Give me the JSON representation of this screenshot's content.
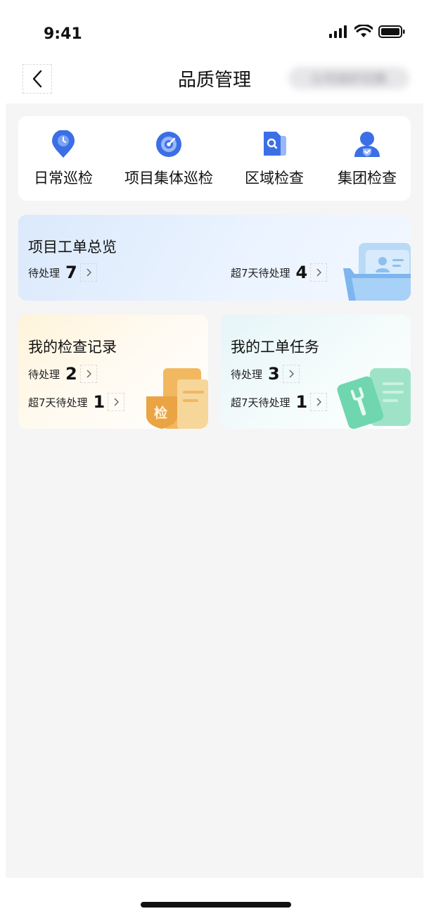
{
  "status": {
    "time": "9:41"
  },
  "nav": {
    "title": "品质管理",
    "right_label": "公司组织切换"
  },
  "quick_actions": [
    {
      "label": "日常巡检",
      "icon": "location-pin-icon"
    },
    {
      "label": "项目集体巡检",
      "icon": "target-icon"
    },
    {
      "label": "区域检查",
      "icon": "document-search-icon"
    },
    {
      "label": "集团检查",
      "icon": "user-shield-icon"
    }
  ],
  "overview": {
    "title": "项目工单总览",
    "pending_label": "待处理",
    "pending_count": "7",
    "overdue_label": "超7天待处理",
    "overdue_count": "4"
  },
  "inspection": {
    "title": "我的检查记录",
    "pending_label": "待处理",
    "pending_count": "2",
    "overdue_label": "超7天待处理",
    "overdue_count": "1",
    "badge_char": "检"
  },
  "tasks": {
    "title": "我的工单任务",
    "pending_label": "待处理",
    "pending_count": "3",
    "overdue_label": "超7天待处理",
    "overdue_count": "1"
  },
  "colors": {
    "accent": "#3b6fe6",
    "orange": "#f0a93b",
    "green": "#6fd6b0"
  }
}
